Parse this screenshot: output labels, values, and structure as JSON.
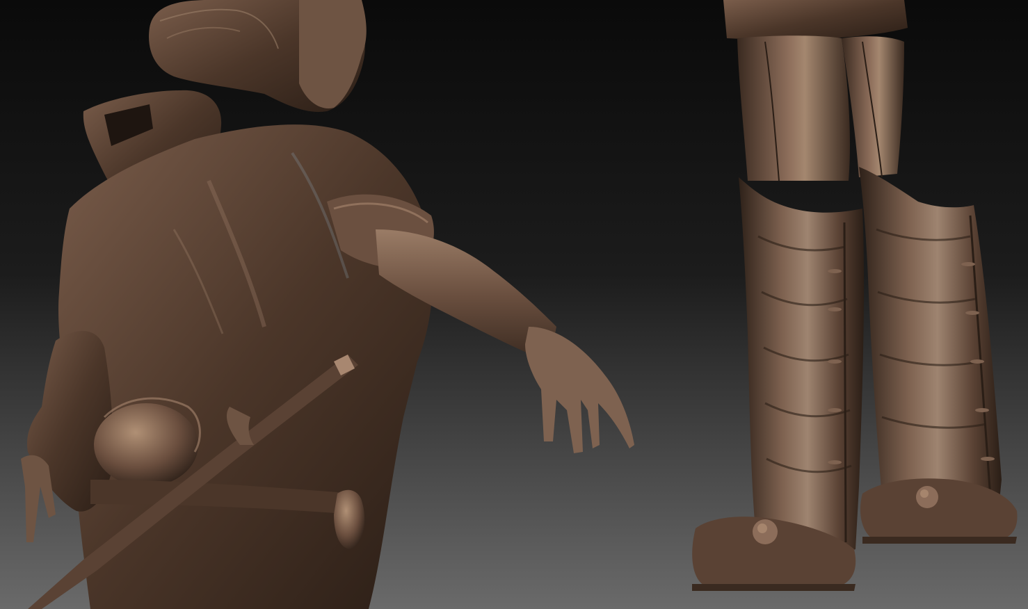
{
  "scene": {
    "subject": "sculpt-render",
    "material_colors": {
      "bronze_dark": "#2c2018",
      "bronze_mid": "#6b5040",
      "bronze_light": "#a88770",
      "highlight_blue": "#8aa4b4"
    },
    "background_colors": {
      "top": "#0c0c0c",
      "bottom": "#6a6a6a"
    }
  }
}
